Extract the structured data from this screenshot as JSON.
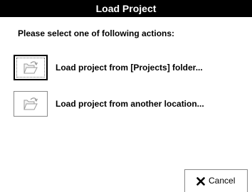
{
  "window": {
    "title": "Load Project"
  },
  "prompt": "Please select one of following actions:",
  "actions": [
    {
      "label": "Load project from [Projects] folder...",
      "icon": "open-folder-icon",
      "focused": true
    },
    {
      "label": "Load project from another location...",
      "icon": "open-folder-icon",
      "focused": false
    }
  ],
  "buttons": {
    "cancel_label": "Cancel",
    "cancel_icon": "close-x-icon"
  }
}
